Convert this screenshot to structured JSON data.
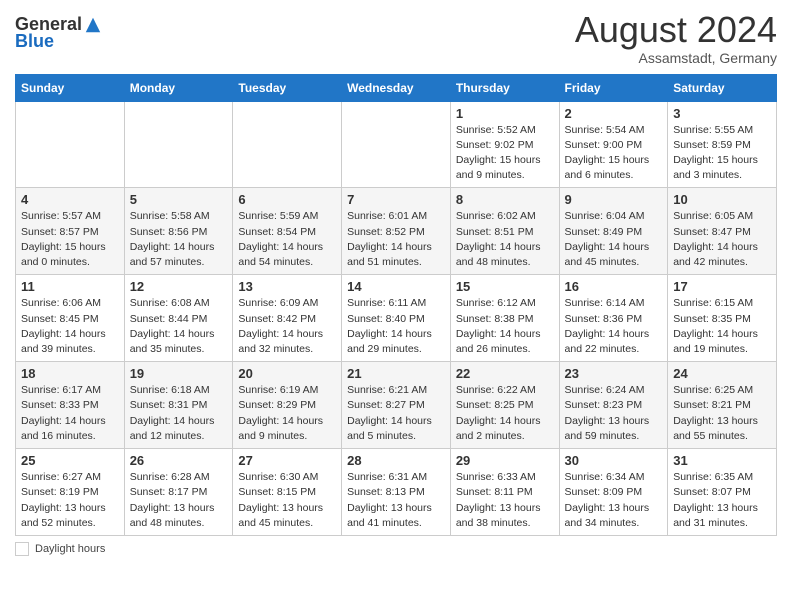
{
  "header": {
    "logo_general": "General",
    "logo_blue": "Blue",
    "month_year": "August 2024",
    "location": "Assamstadt, Germany"
  },
  "days_of_week": [
    "Sunday",
    "Monday",
    "Tuesday",
    "Wednesday",
    "Thursday",
    "Friday",
    "Saturday"
  ],
  "footer": {
    "daylight_label": "Daylight hours"
  },
  "weeks": [
    [
      {
        "day": "",
        "info": ""
      },
      {
        "day": "",
        "info": ""
      },
      {
        "day": "",
        "info": ""
      },
      {
        "day": "",
        "info": ""
      },
      {
        "day": "1",
        "info": "Sunrise: 5:52 AM\nSunset: 9:02 PM\nDaylight: 15 hours and 9 minutes."
      },
      {
        "day": "2",
        "info": "Sunrise: 5:54 AM\nSunset: 9:00 PM\nDaylight: 15 hours and 6 minutes."
      },
      {
        "day": "3",
        "info": "Sunrise: 5:55 AM\nSunset: 8:59 PM\nDaylight: 15 hours and 3 minutes."
      }
    ],
    [
      {
        "day": "4",
        "info": "Sunrise: 5:57 AM\nSunset: 8:57 PM\nDaylight: 15 hours and 0 minutes."
      },
      {
        "day": "5",
        "info": "Sunrise: 5:58 AM\nSunset: 8:56 PM\nDaylight: 14 hours and 57 minutes."
      },
      {
        "day": "6",
        "info": "Sunrise: 5:59 AM\nSunset: 8:54 PM\nDaylight: 14 hours and 54 minutes."
      },
      {
        "day": "7",
        "info": "Sunrise: 6:01 AM\nSunset: 8:52 PM\nDaylight: 14 hours and 51 minutes."
      },
      {
        "day": "8",
        "info": "Sunrise: 6:02 AM\nSunset: 8:51 PM\nDaylight: 14 hours and 48 minutes."
      },
      {
        "day": "9",
        "info": "Sunrise: 6:04 AM\nSunset: 8:49 PM\nDaylight: 14 hours and 45 minutes."
      },
      {
        "day": "10",
        "info": "Sunrise: 6:05 AM\nSunset: 8:47 PM\nDaylight: 14 hours and 42 minutes."
      }
    ],
    [
      {
        "day": "11",
        "info": "Sunrise: 6:06 AM\nSunset: 8:45 PM\nDaylight: 14 hours and 39 minutes."
      },
      {
        "day": "12",
        "info": "Sunrise: 6:08 AM\nSunset: 8:44 PM\nDaylight: 14 hours and 35 minutes."
      },
      {
        "day": "13",
        "info": "Sunrise: 6:09 AM\nSunset: 8:42 PM\nDaylight: 14 hours and 32 minutes."
      },
      {
        "day": "14",
        "info": "Sunrise: 6:11 AM\nSunset: 8:40 PM\nDaylight: 14 hours and 29 minutes."
      },
      {
        "day": "15",
        "info": "Sunrise: 6:12 AM\nSunset: 8:38 PM\nDaylight: 14 hours and 26 minutes."
      },
      {
        "day": "16",
        "info": "Sunrise: 6:14 AM\nSunset: 8:36 PM\nDaylight: 14 hours and 22 minutes."
      },
      {
        "day": "17",
        "info": "Sunrise: 6:15 AM\nSunset: 8:35 PM\nDaylight: 14 hours and 19 minutes."
      }
    ],
    [
      {
        "day": "18",
        "info": "Sunrise: 6:17 AM\nSunset: 8:33 PM\nDaylight: 14 hours and 16 minutes."
      },
      {
        "day": "19",
        "info": "Sunrise: 6:18 AM\nSunset: 8:31 PM\nDaylight: 14 hours and 12 minutes."
      },
      {
        "day": "20",
        "info": "Sunrise: 6:19 AM\nSunset: 8:29 PM\nDaylight: 14 hours and 9 minutes."
      },
      {
        "day": "21",
        "info": "Sunrise: 6:21 AM\nSunset: 8:27 PM\nDaylight: 14 hours and 5 minutes."
      },
      {
        "day": "22",
        "info": "Sunrise: 6:22 AM\nSunset: 8:25 PM\nDaylight: 14 hours and 2 minutes."
      },
      {
        "day": "23",
        "info": "Sunrise: 6:24 AM\nSunset: 8:23 PM\nDaylight: 13 hours and 59 minutes."
      },
      {
        "day": "24",
        "info": "Sunrise: 6:25 AM\nSunset: 8:21 PM\nDaylight: 13 hours and 55 minutes."
      }
    ],
    [
      {
        "day": "25",
        "info": "Sunrise: 6:27 AM\nSunset: 8:19 PM\nDaylight: 13 hours and 52 minutes."
      },
      {
        "day": "26",
        "info": "Sunrise: 6:28 AM\nSunset: 8:17 PM\nDaylight: 13 hours and 48 minutes."
      },
      {
        "day": "27",
        "info": "Sunrise: 6:30 AM\nSunset: 8:15 PM\nDaylight: 13 hours and 45 minutes."
      },
      {
        "day": "28",
        "info": "Sunrise: 6:31 AM\nSunset: 8:13 PM\nDaylight: 13 hours and 41 minutes."
      },
      {
        "day": "29",
        "info": "Sunrise: 6:33 AM\nSunset: 8:11 PM\nDaylight: 13 hours and 38 minutes."
      },
      {
        "day": "30",
        "info": "Sunrise: 6:34 AM\nSunset: 8:09 PM\nDaylight: 13 hours and 34 minutes."
      },
      {
        "day": "31",
        "info": "Sunrise: 6:35 AM\nSunset: 8:07 PM\nDaylight: 13 hours and 31 minutes."
      }
    ]
  ]
}
